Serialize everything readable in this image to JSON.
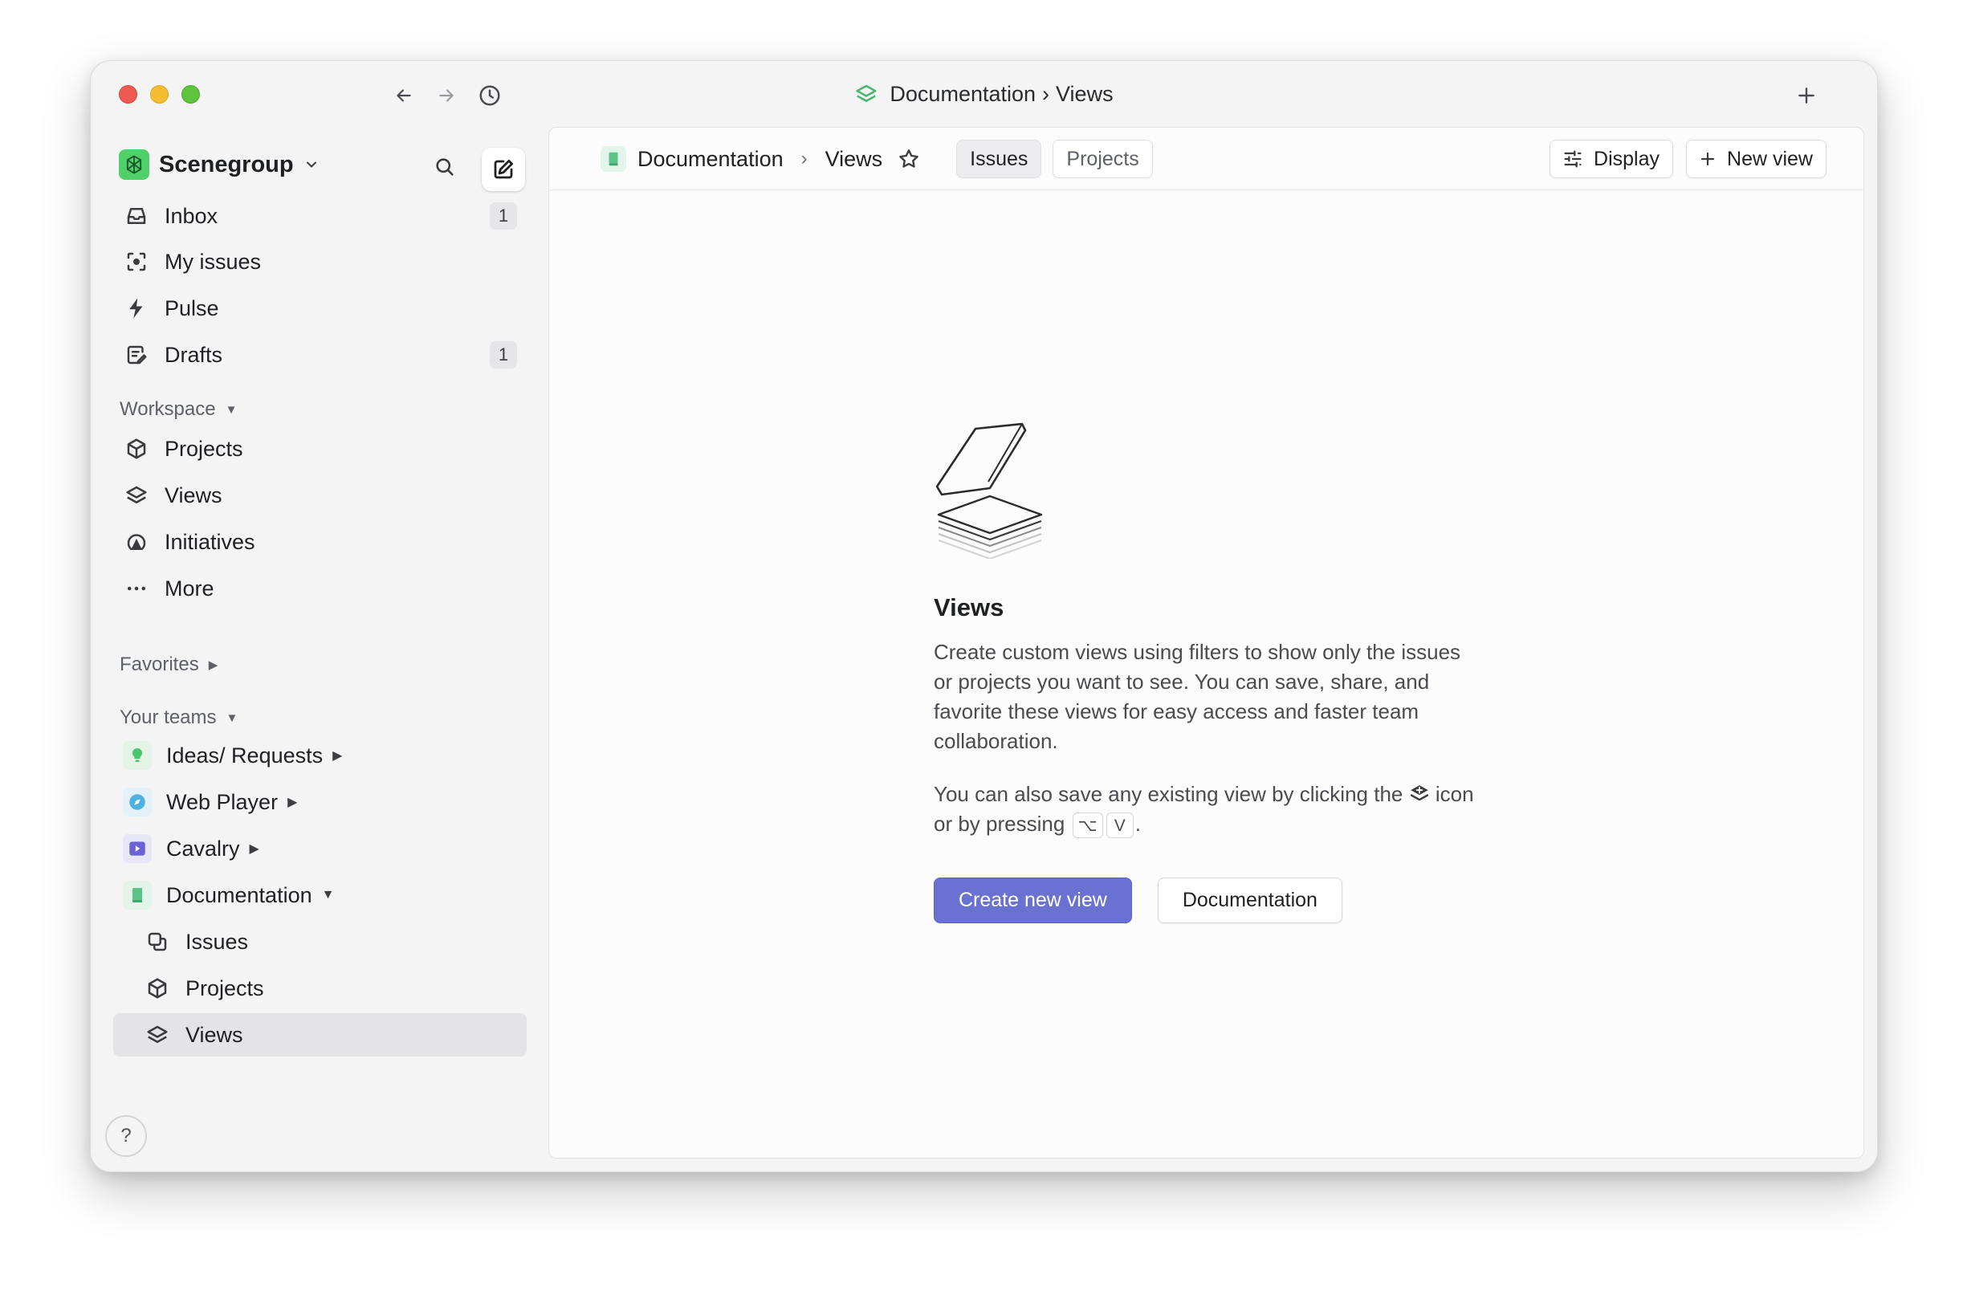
{
  "window": {
    "title_parent": "Documentation",
    "title_sep": "›",
    "title_current": "Views",
    "colors": {
      "close": "#ee5a52",
      "minimize": "#f5bd32",
      "maximize": "#5ec43d"
    }
  },
  "sidebar": {
    "workspace_name": "Scenegroup",
    "workspace_color": "#4fd068",
    "primary_items": [
      {
        "label": "Inbox",
        "icon": "inbox-icon",
        "badge": "1"
      },
      {
        "label": "My issues",
        "icon": "my-issues-icon"
      },
      {
        "label": "Pulse",
        "icon": "pulse-icon"
      },
      {
        "label": "Drafts",
        "icon": "drafts-icon",
        "badge": "1"
      }
    ],
    "workspace_section": "Workspace",
    "workspace_items": [
      {
        "label": "Projects",
        "icon": "cube-icon"
      },
      {
        "label": "Views",
        "icon": "layers-icon"
      },
      {
        "label": "Initiatives",
        "icon": "initiatives-icon"
      },
      {
        "label": "More",
        "icon": "more-icon"
      }
    ],
    "favorites_section": "Favorites",
    "teams_section": "Your teams",
    "teams": [
      {
        "label": "Ideas/ Requests",
        "icon": "lightbulb-icon",
        "color": "#4cc46a"
      },
      {
        "label": "Web Player",
        "icon": "compass-icon",
        "color": "#4fb1e0"
      },
      {
        "label": "Cavalry",
        "icon": "play-icon",
        "color": "#6a63d6"
      },
      {
        "label": "Documentation",
        "icon": "book-icon",
        "color": "#5cc486"
      }
    ],
    "team_subitems": [
      {
        "label": "Issues",
        "icon": "issues-icon"
      },
      {
        "label": "Projects",
        "icon": "cube-icon"
      },
      {
        "label": "Views",
        "icon": "layers-icon",
        "active": true
      }
    ],
    "help_label": "?"
  },
  "main": {
    "breadcrumb_team": "Documentation",
    "breadcrumb_sep": "›",
    "breadcrumb_page": "Views",
    "tabs": [
      {
        "label": "Issues",
        "active": true
      },
      {
        "label": "Projects",
        "active": false
      }
    ],
    "display_label": "Display",
    "new_view_label": "New view",
    "empty_state": {
      "title": "Views",
      "description": "Create custom views using filters to show only the issues or projects you want to see. You can save, share, and favorite these views for easy access and faster team collaboration.",
      "hint_before": "You can also save any existing view by clicking the",
      "hint_middle": "icon or by pressing",
      "shortcut_key_1": "⌥",
      "shortcut_key_2": "V",
      "hint_after": ".",
      "primary_button": "Create new view",
      "secondary_button": "Documentation",
      "accent": "#6a72d1"
    }
  }
}
